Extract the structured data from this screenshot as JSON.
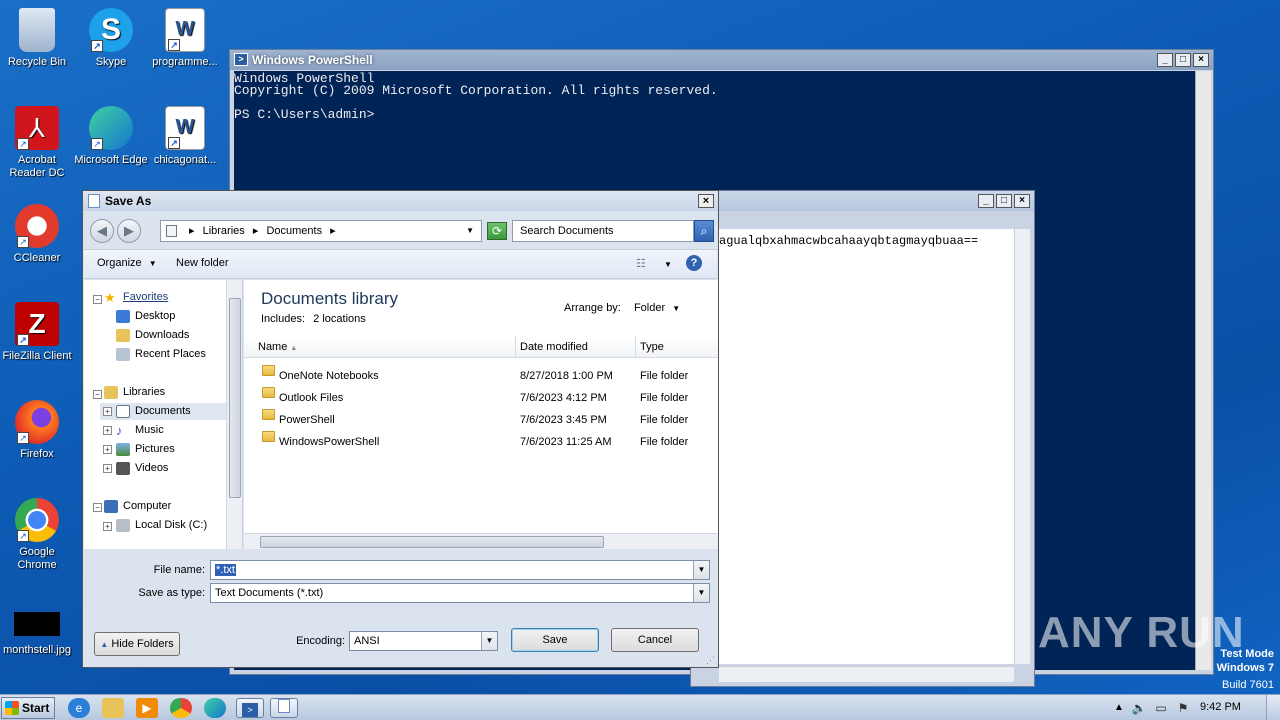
{
  "desktop_icons": [
    {
      "label": "Recycle Bin",
      "icon": "recycle-bin-icon"
    },
    {
      "label": "Skype",
      "icon": "skype-icon"
    },
    {
      "label": "programme...",
      "icon": "word-doc-icon"
    },
    {
      "label": "Acrobat Reader DC",
      "icon": "acrobat-icon"
    },
    {
      "label": "Microsoft Edge",
      "icon": "edge-icon"
    },
    {
      "label": "chicagonat...",
      "icon": "word-doc-icon"
    },
    {
      "label": "CCleaner",
      "icon": "ccleaner-icon"
    },
    {
      "label": "FileZilla Client",
      "icon": "filezilla-icon"
    },
    {
      "label": "Firefox",
      "icon": "firefox-icon"
    },
    {
      "label": "Google Chrome",
      "icon": "chrome-icon"
    },
    {
      "label": "monthstell.jpg",
      "icon": "image-file-icon"
    }
  ],
  "powershell": {
    "title": "Windows PowerShell",
    "line1": "Windows PowerShell",
    "line2": "Copyright (C) 2009 Microsoft Corporation. All rights reserved.",
    "line3": "PS C:\\Users\\admin>"
  },
  "notepad": {
    "text": "agualqbxahmacwbcahaayqbtagmayqbuaa=="
  },
  "dialog": {
    "title": "Save As",
    "breadcrumb": [
      "Libraries",
      "Documents"
    ],
    "search_placeholder": "Search Documents",
    "toolbar": {
      "organize": "Organize",
      "new_folder": "New folder"
    },
    "nav": {
      "favorites": "Favorites",
      "desktop": "Desktop",
      "downloads": "Downloads",
      "recent": "Recent Places",
      "libraries": "Libraries",
      "documents": "Documents",
      "music": "Music",
      "pictures": "Pictures",
      "videos": "Videos",
      "computer": "Computer",
      "local_disk": "Local Disk (C:)"
    },
    "library_title": "Documents library",
    "includes_label": "Includes:",
    "includes_value": "2 locations",
    "arrange_label": "Arrange by:",
    "arrange_value": "Folder",
    "columns": {
      "name": "Name",
      "date": "Date modified",
      "type": "Type"
    },
    "files": [
      {
        "name": "OneNote Notebooks",
        "date": "8/27/2018 1:00 PM",
        "type": "File folder"
      },
      {
        "name": "Outlook Files",
        "date": "7/6/2023 4:12 PM",
        "type": "File folder"
      },
      {
        "name": "PowerShell",
        "date": "7/6/2023 3:45 PM",
        "type": "File folder"
      },
      {
        "name": "WindowsPowerShell",
        "date": "7/6/2023 11:25 AM",
        "type": "File folder"
      }
    ],
    "file_name_label": "File name:",
    "file_name_value": "*.txt",
    "save_type_label": "Save as type:",
    "save_type_value": "Text Documents (*.txt)",
    "hide_folders": "Hide Folders",
    "encoding_label": "Encoding:",
    "encoding_value": "ANSI",
    "save_button": "Save",
    "cancel_button": "Cancel"
  },
  "taskbar": {
    "start": "Start",
    "time": "9:42 PM"
  },
  "watermark": "ANY RUN",
  "test_mode": {
    "line1": "Test Mode",
    "line2": "Windows 7",
    "line3": "Build 7601"
  }
}
